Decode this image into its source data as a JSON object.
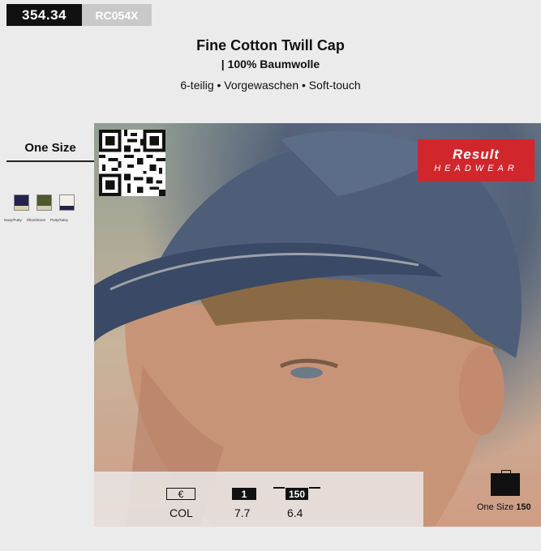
{
  "product": {
    "code": "354.34",
    "model": "RC054X",
    "title": "Fine Cotton Twill Cap",
    "subtitle": "| 100% Baumwolle",
    "features": "6-teilig • Vorgewaschen • Soft-touch"
  },
  "sizes": {
    "label": "One Size"
  },
  "colors": [
    {
      "name": "Navy/Putty",
      "top": "#23224a",
      "bottom": "#d9cfb0"
    },
    {
      "name": "Olive/Stone",
      "top": "#4e5a2a",
      "bottom": "#d4ccb4"
    },
    {
      "name": "Putty/Navy",
      "top": "#f1efe8",
      "bottom": "#23224a"
    }
  ],
  "brand": {
    "line1": "Result",
    "line2": "HEADWEAR",
    "color": "#d2262d"
  },
  "pricing": {
    "currency_symbol": "€",
    "col_label": "COL",
    "qty1": "1",
    "qty2": "150",
    "price1": "7.7",
    "price2": "6.4"
  },
  "packaging": {
    "label": "One Size",
    "count": "150"
  }
}
